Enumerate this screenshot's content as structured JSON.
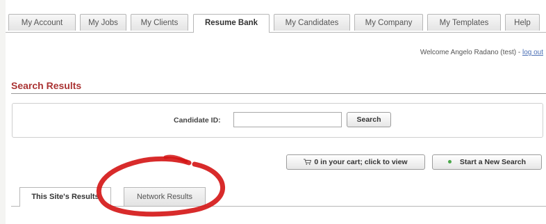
{
  "nav": {
    "tabs": [
      {
        "label": "My Account"
      },
      {
        "label": "My Jobs"
      },
      {
        "label": "My Clients"
      },
      {
        "label": "Resume Bank",
        "active": true
      },
      {
        "label": "My Candidates"
      },
      {
        "label": "My Company"
      },
      {
        "label": "My Templates"
      },
      {
        "label": "Help"
      }
    ]
  },
  "header": {
    "welcome_text": "Welcome Angelo Radano (test) -",
    "logout_label": "log out"
  },
  "page": {
    "title": "Search Results"
  },
  "search": {
    "label": "Candidate ID:",
    "input_value": "",
    "button_label": "Search"
  },
  "actions": {
    "cart_label": "0 in your cart; click to view",
    "new_search_label": "Start a New Search"
  },
  "results": {
    "tabs": [
      {
        "label": "This Site's Results",
        "active": true
      },
      {
        "label": "Network Results"
      }
    ]
  },
  "colors": {
    "accent_title": "#a33333",
    "annotation_circle": "#d41414",
    "status_dot": "#4aa84a"
  }
}
